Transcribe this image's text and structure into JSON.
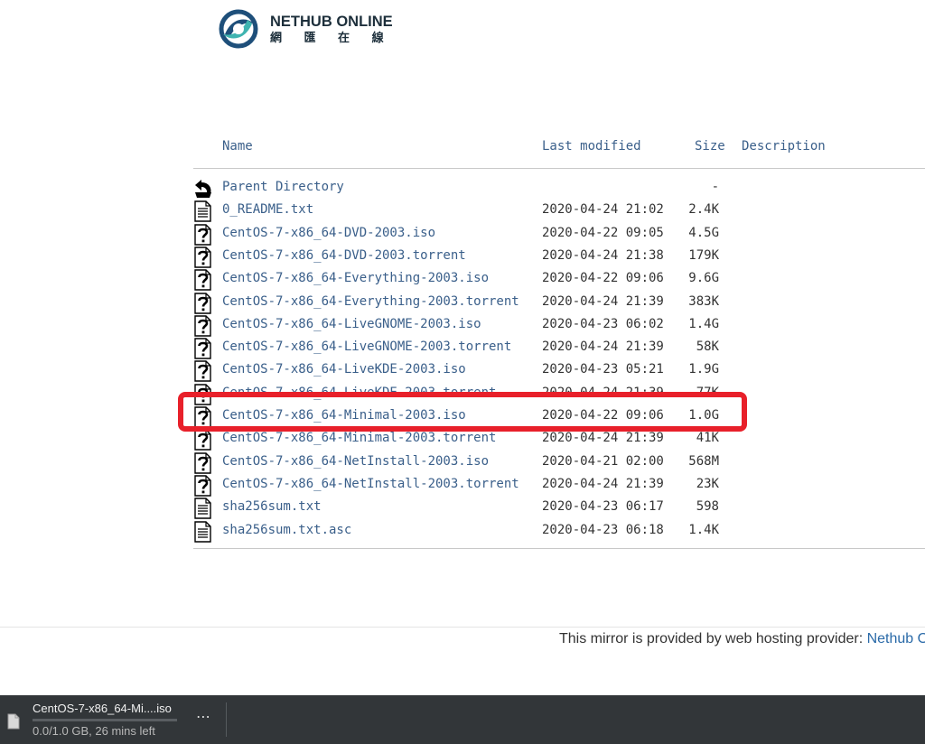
{
  "logo": {
    "name": "NETHUB ONLINE",
    "subtitle": "網 匯 在 線"
  },
  "listing": {
    "columns": {
      "name": "Name",
      "modified": "Last modified",
      "size": "Size",
      "description": "Description"
    },
    "rows": [
      {
        "icon": "back-icon",
        "name": "Parent Directory",
        "date": "",
        "size": "-"
      },
      {
        "icon": "text-file-icon",
        "name": "0_README.txt",
        "date": "2020-04-24 21:02",
        "size": "2.4K"
      },
      {
        "icon": "unknown-file-icon",
        "name": "CentOS-7-x86_64-DVD-2003.iso",
        "date": "2020-04-22 09:05",
        "size": "4.5G"
      },
      {
        "icon": "unknown-file-icon",
        "name": "CentOS-7-x86_64-DVD-2003.torrent",
        "date": "2020-04-24 21:38",
        "size": "179K"
      },
      {
        "icon": "unknown-file-icon",
        "name": "CentOS-7-x86_64-Everything-2003.iso",
        "date": "2020-04-22 09:06",
        "size": "9.6G"
      },
      {
        "icon": "unknown-file-icon",
        "name": "CentOS-7-x86_64-Everything-2003.torrent",
        "date": "2020-04-24 21:39",
        "size": "383K"
      },
      {
        "icon": "unknown-file-icon",
        "name": "CentOS-7-x86_64-LiveGNOME-2003.iso",
        "date": "2020-04-23 06:02",
        "size": "1.4G"
      },
      {
        "icon": "unknown-file-icon",
        "name": "CentOS-7-x86_64-LiveGNOME-2003.torrent",
        "date": "2020-04-24 21:39",
        "size": "58K"
      },
      {
        "icon": "unknown-file-icon",
        "name": "CentOS-7-x86_64-LiveKDE-2003.iso",
        "date": "2020-04-23 05:21",
        "size": "1.9G"
      },
      {
        "icon": "unknown-file-icon",
        "name": "CentOS-7-x86_64-LiveKDE-2003.torrent",
        "date": "2020-04-24 21:39",
        "size": "77K"
      },
      {
        "icon": "unknown-file-icon",
        "name": "CentOS-7-x86_64-Minimal-2003.iso",
        "date": "2020-04-22 09:06",
        "size": "1.0G"
      },
      {
        "icon": "unknown-file-icon",
        "name": "CentOS-7-x86_64-Minimal-2003.torrent",
        "date": "2020-04-24 21:39",
        "size": "41K"
      },
      {
        "icon": "unknown-file-icon",
        "name": "CentOS-7-x86_64-NetInstall-2003.iso",
        "date": "2020-04-21 02:00",
        "size": "568M"
      },
      {
        "icon": "unknown-file-icon",
        "name": "CentOS-7-x86_64-NetInstall-2003.torrent",
        "date": "2020-04-24 21:39",
        "size": "23K"
      },
      {
        "icon": "text-file-icon",
        "name": "sha256sum.txt",
        "date": "2020-04-23 06:17",
        "size": "598"
      },
      {
        "icon": "text-file-icon",
        "name": "sha256sum.txt.asc",
        "date": "2020-04-23 06:18",
        "size": "1.4K"
      }
    ]
  },
  "highlight": {
    "row_index": 10,
    "color": "#e8202a"
  },
  "footer": {
    "text": "This mirror is provided by web hosting provider: ",
    "link": "Nethub Online"
  },
  "download": {
    "file_icon": "file-icon",
    "name": "CentOS-7-x86_64-Mi....iso",
    "status": "0.0/1.0 GB, 26 mins left",
    "progress": 0.0,
    "menu": "⋯"
  }
}
